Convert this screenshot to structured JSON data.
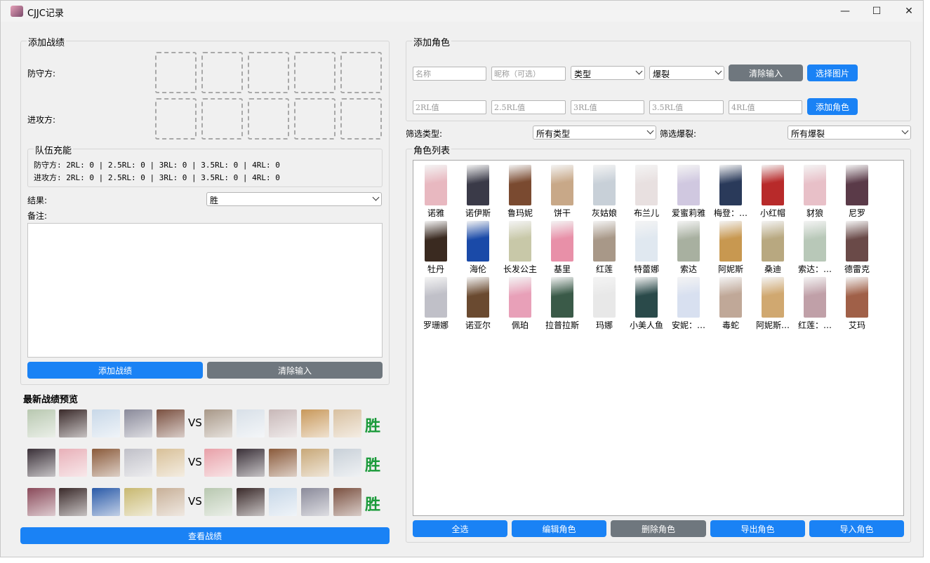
{
  "window": {
    "title": "CJJC记录",
    "minimize_glyph": "—",
    "maximize_glyph": "☐",
    "close_glyph": "✕"
  },
  "add_record": {
    "group_title": "添加战绩",
    "defender_label": "防守方:",
    "attacker_label": "进攻方:",
    "team_charge": {
      "title": "队伍充能",
      "defender_line": "防守方: 2RL: 0 | 2.5RL: 0 | 3RL: 0 | 3.5RL: 0 | 4RL: 0",
      "attacker_line": "进攻方: 2RL: 0 | 2.5RL: 0 | 3RL: 0 | 3.5RL: 0 | 4RL: 0"
    },
    "result_label": "结果:",
    "result_value": "胜",
    "notes_label": "备注:",
    "add_button": "添加战绩",
    "clear_button": "清除输入"
  },
  "preview": {
    "title": "最新战绩预览",
    "vs_text": "VS",
    "rows": [
      {
        "result": "胜",
        "left_colors": [
          "#b8c8b0",
          "#3a2a2a",
          "#c8d8e8",
          "#8a8a9a",
          "#7a5040"
        ],
        "right_colors": [
          "#a89888",
          "#d8e0e8",
          "#c8b8b8",
          "#c8985a",
          "#d8c0a0"
        ]
      },
      {
        "result": "胜",
        "left_colors": [
          "#3a3038",
          "#e8b0b8",
          "#8a5a3a",
          "#c0c0c8",
          "#d8c098"
        ],
        "right_colors": [
          "#e8a0a8",
          "#3a3038",
          "#8a5a3a",
          "#c8a878",
          "#c8d0d8"
        ]
      },
      {
        "result": "胜",
        "left_colors": [
          "#8a4a5a",
          "#3a2a2a",
          "#2a5aa8",
          "#c8b870",
          "#c8b098"
        ],
        "right_colors": [
          "#b8c8b0",
          "#3a2a2a",
          "#c8d8e8",
          "#8a8a9a",
          "#7a5040"
        ]
      }
    ],
    "view_button": "查看战绩"
  },
  "add_character": {
    "group_title": "添加角色",
    "name_placeholder": "名称",
    "nickname_placeholder": "昵称（可选）",
    "type_value": "类型",
    "burst_value": "爆裂",
    "clear_button": "清除输入",
    "choose_image_button": "选择图片",
    "rl2_placeholder": "2RL值",
    "rl25_placeholder": "2.5RL值",
    "rl3_placeholder": "3RL值",
    "rl35_placeholder": "3.5RL值",
    "rl4_placeholder": "4RL值",
    "add_button": "添加角色"
  },
  "filter": {
    "type_label": "筛选类型:",
    "type_value": "所有类型",
    "burst_label": "筛选爆裂:",
    "burst_value": "所有爆裂"
  },
  "character_list": {
    "title": "角色列表",
    "characters": [
      {
        "name": "诺雅",
        "color": "#e8b8c0"
      },
      {
        "name": "诺伊斯",
        "color": "#3a3a48"
      },
      {
        "name": "鲁玛妮",
        "color": "#7a4a30"
      },
      {
        "name": "饼干",
        "color": "#c8a888"
      },
      {
        "name": "灰姑娘",
        "color": "#c8d0d8"
      },
      {
        "name": "布兰儿",
        "color": "#e8e0e0"
      },
      {
        "name": "爱蜜莉雅",
        "color": "#d0c8e0"
      },
      {
        "name": "梅登：…",
        "color": "#2a3a5a"
      },
      {
        "name": "小红帽",
        "color": "#b82a2a"
      },
      {
        "name": "豺狼",
        "color": "#e8c0c8"
      },
      {
        "name": "尼罗",
        "color": "#5a3a48"
      },
      {
        "name": "牡丹",
        "color": "#3a2a20"
      },
      {
        "name": "海伦",
        "color": "#1a4aa8"
      },
      {
        "name": "长发公主",
        "color": "#c8c8a8"
      },
      {
        "name": "基里",
        "color": "#e890a8"
      },
      {
        "name": "红莲",
        "color": "#a89888"
      },
      {
        "name": "特蕾娜",
        "color": "#e0e8f0"
      },
      {
        "name": "索达",
        "color": "#a8b0a0"
      },
      {
        "name": "阿妮斯",
        "color": "#c89850"
      },
      {
        "name": "桑迪",
        "color": "#b8a880"
      },
      {
        "name": "索达：…",
        "color": "#b8c8b8"
      },
      {
        "name": "德雷克",
        "color": "#6a4a48"
      },
      {
        "name": "罗珊娜",
        "color": "#c0c0c8"
      },
      {
        "name": "诺亚尔",
        "color": "#6a4a30"
      },
      {
        "name": "佩珀",
        "color": "#e8a0b8"
      },
      {
        "name": "拉普拉斯",
        "color": "#3a5a48"
      },
      {
        "name": "玛娜",
        "color": "#e8e8e8"
      },
      {
        "name": "小美人鱼",
        "color": "#2a4a4a"
      },
      {
        "name": "安妮：…",
        "color": "#d8e0f0"
      },
      {
        "name": "毒蛇",
        "color": "#c0a898"
      },
      {
        "name": "阿妮斯…",
        "color": "#d0a870"
      },
      {
        "name": "红莲：…",
        "color": "#c0a0a8"
      },
      {
        "name": "艾玛",
        "color": "#a06048"
      }
    ]
  },
  "bottom_actions": {
    "select_all": "全选",
    "edit": "编辑角色",
    "delete": "删除角色",
    "export": "导出角色",
    "import": "导入角色"
  }
}
